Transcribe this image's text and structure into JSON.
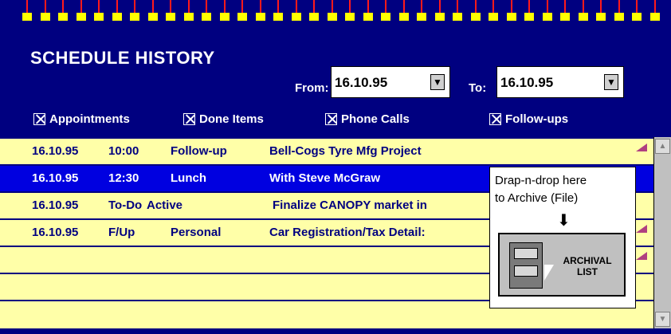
{
  "app": {
    "title": "SCHEDULE HISTORY",
    "from_label": "From:",
    "from_value": "16.10.95",
    "to_label": "To:",
    "to_value": "16.10.95",
    "spin_icon": "▼"
  },
  "filters": [
    {
      "label": "Appointments",
      "checked": true
    },
    {
      "label": "Done Items",
      "checked": true
    },
    {
      "label": "Phone Calls",
      "checked": true
    },
    {
      "label": "Follow-ups",
      "checked": true
    }
  ],
  "rows": [
    {
      "date": "16.10.95",
      "time": "10:00",
      "type": "Follow-up",
      "desc": "Bell-Cogs Tyre Mfg Project",
      "selected": false
    },
    {
      "date": "16.10.95",
      "time": "12:30",
      "type": "Lunch",
      "desc": "With Steve McGraw",
      "selected": true
    },
    {
      "date": "16.10.95",
      "time": "To-Do",
      "type": "Active",
      "desc": "Finalize CANOPY market in",
      "selected": false
    },
    {
      "date": "16.10.95",
      "time": "F/Up",
      "type": "Personal",
      "desc": "Car Registration/Tax Detail:",
      "selected": false
    },
    {
      "date": "",
      "time": "",
      "type": "",
      "desc": "",
      "selected": false
    },
    {
      "date": "",
      "time": "",
      "type": "",
      "desc": "",
      "selected": false
    }
  ],
  "drop_zone": {
    "hint_line1": "Drap-n-drop here",
    "hint_line2": "to Archive (File)",
    "arrow": "⬇",
    "button_line1": "ARCHIVAL",
    "button_line2": "LIST"
  },
  "scrollbar": {
    "up_icon": "▲",
    "down_icon": "▼"
  },
  "colors": {
    "background": "#000080",
    "list_bg": "#ffffa8",
    "selected": "#0000e0",
    "binding_wire": "#ff1a1a",
    "binding_hole": "#ffff00"
  }
}
